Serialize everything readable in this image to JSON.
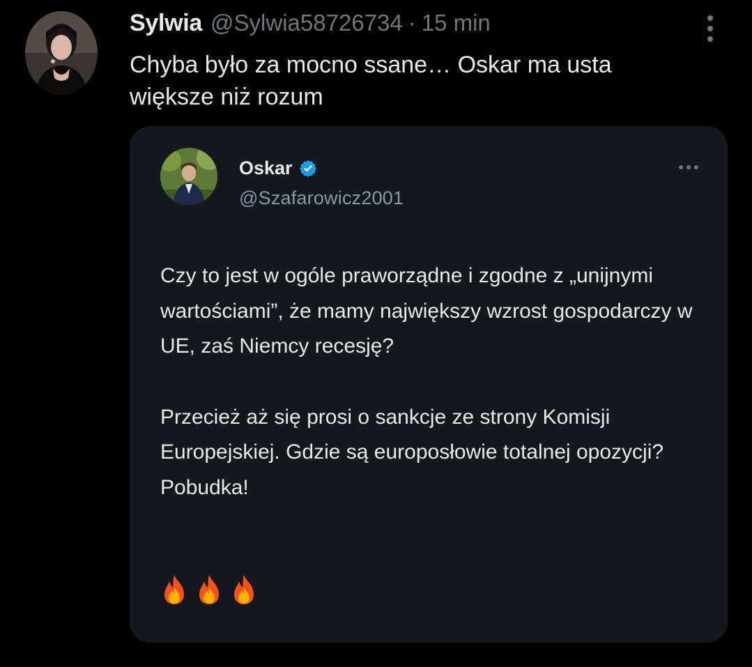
{
  "tweet": {
    "author_name": "Sylwia",
    "author_handle": "@Sylwia58726734",
    "separator": "·",
    "time": "15 min",
    "text": "Chyba było za mocno ssane… Oskar ma usta większe niż rozum",
    "more_icon": "vertical-ellipsis-icon"
  },
  "quoted": {
    "author_name": "Oskar",
    "author_handle": "@Szafarowicz2001",
    "verified": true,
    "verified_color": "#1d9bf0",
    "more_icon": "horizontal-ellipsis-icon",
    "paragraphs": [
      "Czy to jest w ogóle praworządne i zgodne z „unijnymi wartościami”, że mamy największy wzrost gospodarczy w UE, zaś Niemcy recesję?",
      "Przecież aż się prosi o sankcje ze strony Komisji Europejskiej. Gdzie są europosłowie totalnej opozycji? Pobudka!"
    ],
    "emojis": [
      "fire",
      "fire",
      "fire"
    ]
  }
}
